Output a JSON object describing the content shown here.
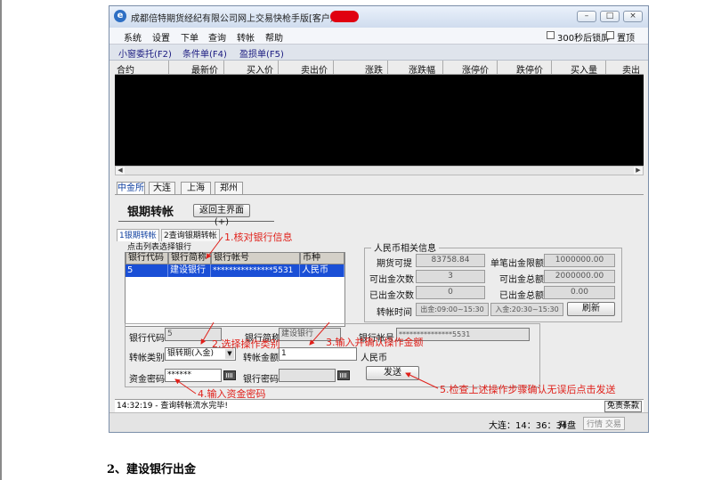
{
  "window": {
    "title": "成都倍特期货经纪有限公司网上交易快枪手版[客户姓名：",
    "controls": [
      "minimize",
      "maximize",
      "close"
    ]
  },
  "menu": [
    "系统",
    "设置",
    "下单",
    "查询",
    "转帐",
    "帮助"
  ],
  "menu_options": {
    "lock": "300秒后锁屏",
    "pin": "置顶"
  },
  "toolbar": [
    "小窗委托(F2)",
    "条件单(F4)",
    "盈损单(F5)"
  ],
  "quote_columns": [
    "合约",
    "最新价",
    "买入价",
    "卖出价",
    "涨跌",
    "涨跌幅",
    "涨停价",
    "跌停价",
    "买入量",
    "卖出"
  ],
  "exchange_tabs": [
    "中金所",
    "大连",
    "上海",
    "郑州"
  ],
  "transfer": {
    "heading": "银期转帐",
    "back_button": "返回主界面(+)",
    "sub_tabs": [
      "1银期转帐",
      "2查询银期转帐"
    ],
    "select_hint": "点击列表选择银行",
    "bank_table": {
      "headers": [
        "银行代码",
        "银行简称",
        "银行帐号",
        "币种"
      ],
      "rows": [
        [
          "5",
          "建设银行",
          "***************5531",
          "人民币"
        ]
      ]
    },
    "rmb_info": {
      "title": "人民币相关信息",
      "fields": {
        "available_label": "期货可提",
        "available_value": "83758.84",
        "single_limit_label": "单笔出金限额",
        "single_limit_value": "1000000.00",
        "count_label": "可出金次数",
        "count_value": "3",
        "total_label": "可出金总额",
        "total_value": "2000000.00",
        "out_count_label": "已出金次数",
        "out_count_value": "0",
        "out_total_label": "已出金总额",
        "out_total_value": "0.00",
        "time_label": "转帐时间",
        "time_out": "出金:09:00~15:30",
        "time_in": "入金:20:30~15:30"
      },
      "refresh_button": "刷新"
    },
    "form": {
      "bank_code_label": "银行代码",
      "bank_code_value": "5",
      "bank_short_label": "银行简称",
      "bank_short_value": "建设银行",
      "bank_account_label": "银行帐号",
      "bank_account_value": "***************5531",
      "type_label": "转帐类别",
      "type_value": "银转期(入金)",
      "amount_label": "转帐金额",
      "amount_value": "1",
      "currency_value": "人民币",
      "fund_pwd_label": "资金密码",
      "fund_pwd_value": "******",
      "bank_pwd_label": "银行密码",
      "bank_pwd_value": "",
      "send_button": "发送"
    }
  },
  "annotations": {
    "a1": "1.核对银行信息",
    "a2": "2.选择操作类别",
    "a3": "3.输入并确认操作金额",
    "a4": "4.输入资金密码",
    "a5": "5.检查上述操作步骤确认无误后点击发送"
  },
  "status": {
    "message": "14:32:19 - 查询转帐流水完毕!",
    "disclaimer": "免责条款",
    "clock": "大连：14：36：34",
    "market": "开盘",
    "tabs": "行情 交易"
  },
  "footer": "2、建设银行出金",
  "colors": {
    "annotation": "#e0201a",
    "selected_row": "#1a4fd6",
    "quote_bg": "#000000"
  }
}
